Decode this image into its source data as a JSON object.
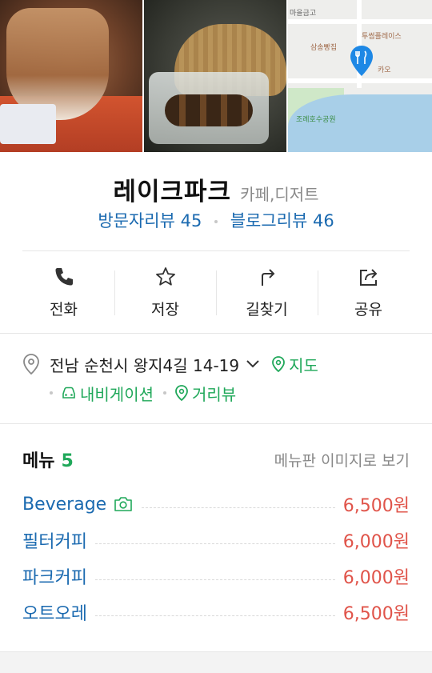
{
  "photos": {
    "map": {
      "labels": [
        "마을금고",
        "삼송빵집",
        "투썸플레이스",
        "카오",
        "조례호수공원"
      ]
    }
  },
  "place": {
    "name": "레이크파크",
    "category": "카페,디저트"
  },
  "reviews": {
    "visitor": "방문자리뷰 45",
    "blog": "블로그리뷰 46"
  },
  "actions": [
    {
      "label": "전화",
      "icon": "phone-icon"
    },
    {
      "label": "저장",
      "icon": "star-icon"
    },
    {
      "label": "길찾기",
      "icon": "directions-icon"
    },
    {
      "label": "공유",
      "icon": "share-icon"
    }
  ],
  "address": {
    "text": "전남 순천시 왕지4길 14-19",
    "map_link": "지도",
    "navigation": "내비게이션",
    "street_view": "거리뷰"
  },
  "menu": {
    "title": "메뉴",
    "count": "5",
    "board_link": "메뉴판 이미지로 보기",
    "items": [
      {
        "name": "Beverage",
        "price": "6,500원",
        "has_photo": true
      },
      {
        "name": "필터커피",
        "price": "6,000원"
      },
      {
        "name": "파크커피",
        "price": "6,000원"
      },
      {
        "name": "오트오레",
        "price": "6,500원"
      }
    ]
  },
  "colors": {
    "link_blue": "#1b6ab0",
    "green": "#20a85a",
    "price_red": "#e0544a",
    "map_pin": "#1e88e5"
  }
}
